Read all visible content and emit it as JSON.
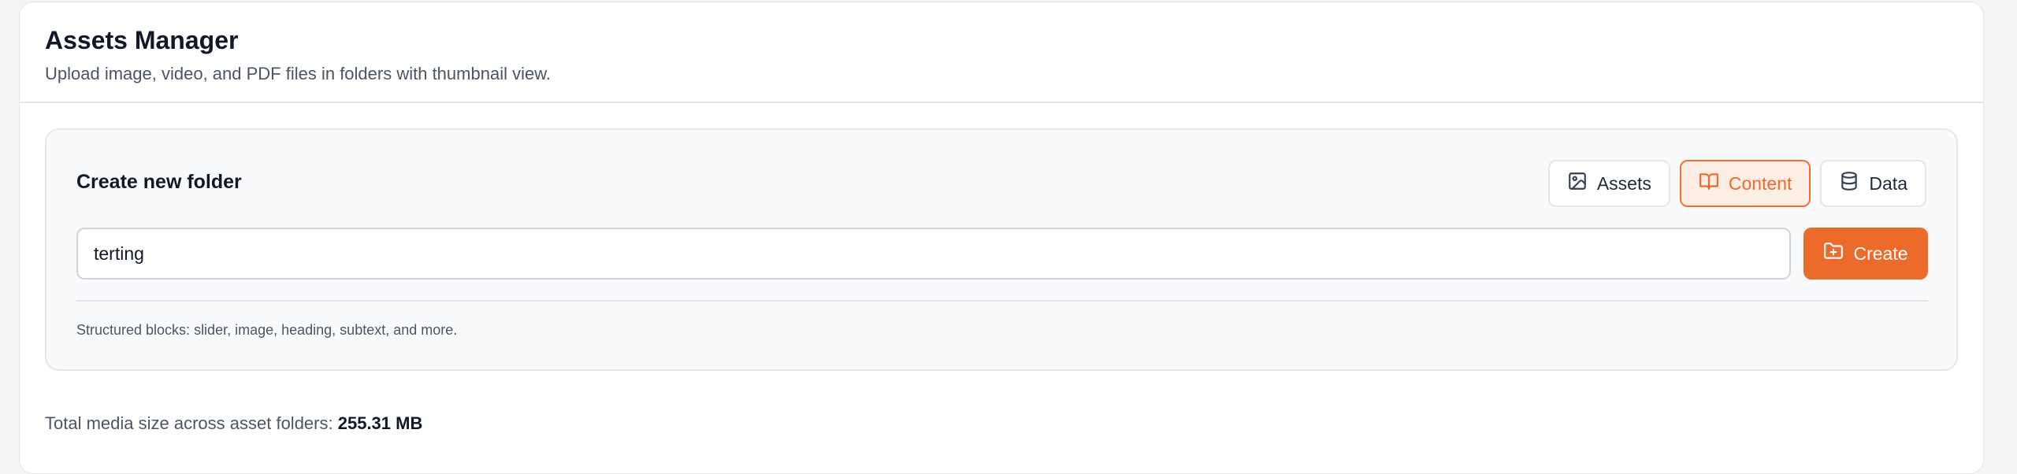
{
  "header": {
    "title": "Assets Manager",
    "subtitle": "Upload image, video, and PDF files in folders with thumbnail view."
  },
  "create_folder": {
    "title": "Create new folder",
    "input_value": "terting",
    "create_label": "Create",
    "hint": "Structured blocks: slider, image, heading, subtext, and more."
  },
  "tabs": [
    {
      "label": "Assets",
      "icon": "image-icon",
      "active": false
    },
    {
      "label": "Content",
      "icon": "book-open-icon",
      "active": true
    },
    {
      "label": "Data",
      "icon": "database-icon",
      "active": false
    }
  ],
  "footer": {
    "total_label": "Total media size across asset folders:",
    "total_value": "255.31 MB"
  },
  "colors": {
    "accent": "#ec6a2a",
    "accent_bg": "#fdeee5",
    "text_primary": "#111827",
    "text_secondary": "#4b5563",
    "border": "#e5e7eb"
  }
}
